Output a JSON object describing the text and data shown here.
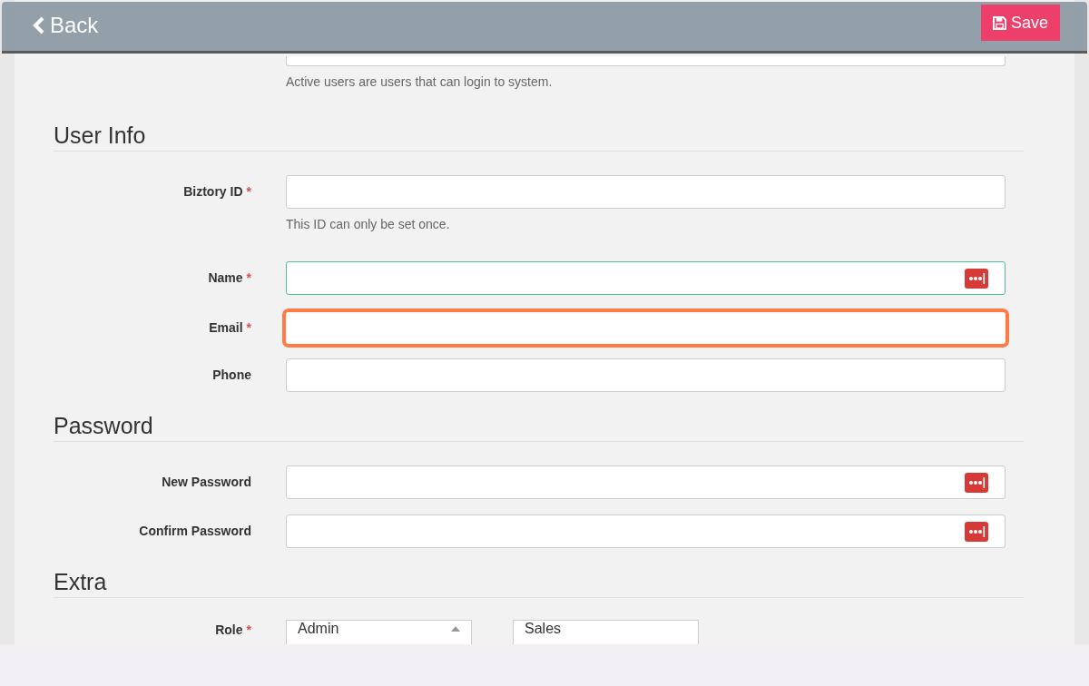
{
  "header": {
    "back": "Back",
    "save": "Save"
  },
  "activate": {
    "help": "Active users are users that can login to system."
  },
  "sections": [
    {
      "title": "User Info",
      "fields": [
        {
          "label": "Biztory ID",
          "required_mark": "*",
          "help": "This ID can only be set once.",
          "valid": false,
          "highlighted": false,
          "password_icon": false
        },
        {
          "label": "Name",
          "required_mark": "*",
          "valid": true,
          "highlighted": false,
          "password_icon": true
        },
        {
          "label": "Email",
          "required_mark": "*",
          "valid": false,
          "highlighted": true,
          "password_icon": false
        },
        {
          "label": "Phone",
          "valid": false,
          "highlighted": false,
          "password_icon": false
        }
      ]
    },
    {
      "title": "Password",
      "fields": [
        {
          "label": "New Password",
          "valid": false,
          "highlighted": false,
          "password_icon": true
        },
        {
          "label": "Confirm Password",
          "valid": false,
          "highlighted": false,
          "password_icon": true
        }
      ]
    },
    {
      "title": "Extra",
      "role": {
        "label": "Role",
        "required_mark": "*",
        "options": [
          "Admin",
          "Sales"
        ]
      }
    }
  ]
}
